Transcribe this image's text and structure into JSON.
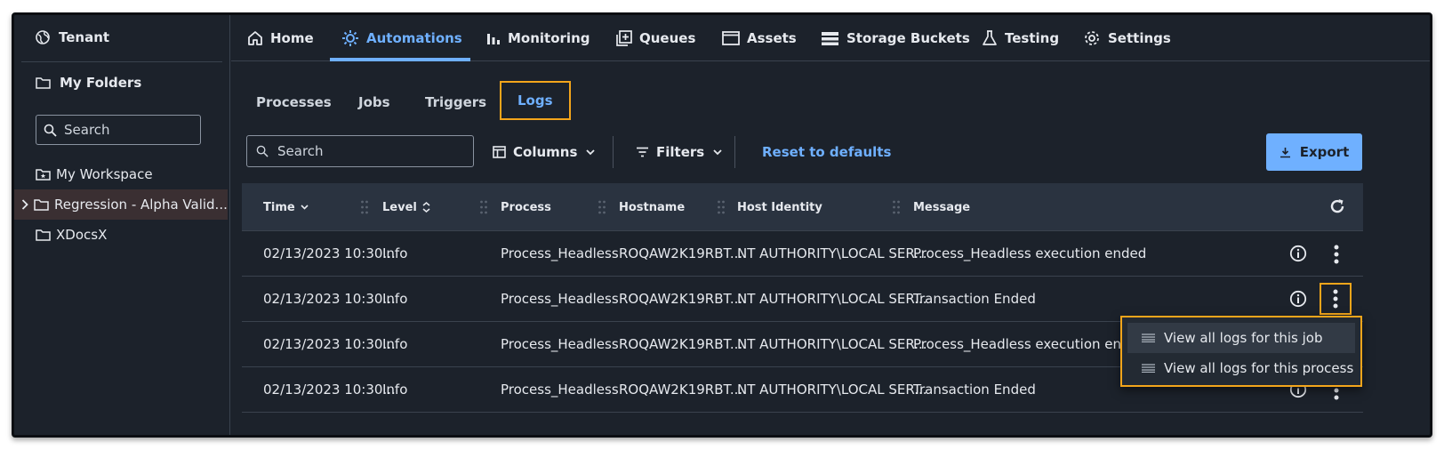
{
  "sidebar": {
    "tenant": "Tenant",
    "my_folders": "My Folders",
    "search_placeholder": "Search",
    "items": [
      {
        "label": "My Workspace"
      },
      {
        "label": "Regression - Alpha Valid..."
      },
      {
        "label": "XDocsX"
      }
    ]
  },
  "nav": {
    "items": [
      {
        "label": "Home"
      },
      {
        "label": "Automations"
      },
      {
        "label": "Monitoring"
      },
      {
        "label": "Queues"
      },
      {
        "label": "Assets"
      },
      {
        "label": "Storage Buckets"
      },
      {
        "label": "Testing"
      },
      {
        "label": "Settings"
      }
    ],
    "active": "Automations"
  },
  "subtabs": {
    "items": [
      {
        "label": "Processes"
      },
      {
        "label": "Jobs"
      },
      {
        "label": "Triggers"
      },
      {
        "label": "Logs"
      }
    ],
    "active": "Logs"
  },
  "toolbar": {
    "search_placeholder": "Search",
    "columns_label": "Columns",
    "filters_label": "Filters",
    "reset_label": "Reset to defaults",
    "export_label": "Export"
  },
  "table": {
    "headers": [
      "Time",
      "Level",
      "Process",
      "Hostname",
      "Host Identity",
      "Message"
    ],
    "rows": [
      {
        "time": "02/13/2023 10:30...",
        "level": "Info",
        "process": "Process_Headless",
        "hostname": "ROQAW2K19RBT...",
        "identity": "NT AUTHORITY\\LOCAL SER...",
        "message": "Process_Headless execution ended"
      },
      {
        "time": "02/13/2023 10:30...",
        "level": "Info",
        "process": "Process_Headless",
        "hostname": "ROQAW2K19RBT...",
        "identity": "NT AUTHORITY\\LOCAL SER...",
        "message": "Transaction Ended"
      },
      {
        "time": "02/13/2023 10:30...",
        "level": "Info",
        "process": "Process_Headless",
        "hostname": "ROQAW2K19RBT...",
        "identity": "NT AUTHORITY\\LOCAL SER...",
        "message": "Process_Headless execution ended"
      },
      {
        "time": "02/13/2023 10:30...",
        "level": "Info",
        "process": "Process_Headless",
        "hostname": "ROQAW2K19RBT...",
        "identity": "NT AUTHORITY\\LOCAL SER...",
        "message": "Transaction Ended"
      }
    ]
  },
  "context_menu": {
    "items": [
      {
        "label": "View all logs for this job"
      },
      {
        "label": "View all logs for this process"
      }
    ]
  },
  "colors": {
    "background": "#1c222b",
    "accent": "#6fb0ff",
    "highlight": "#f3a51b",
    "header_bg": "#2a3340"
  }
}
